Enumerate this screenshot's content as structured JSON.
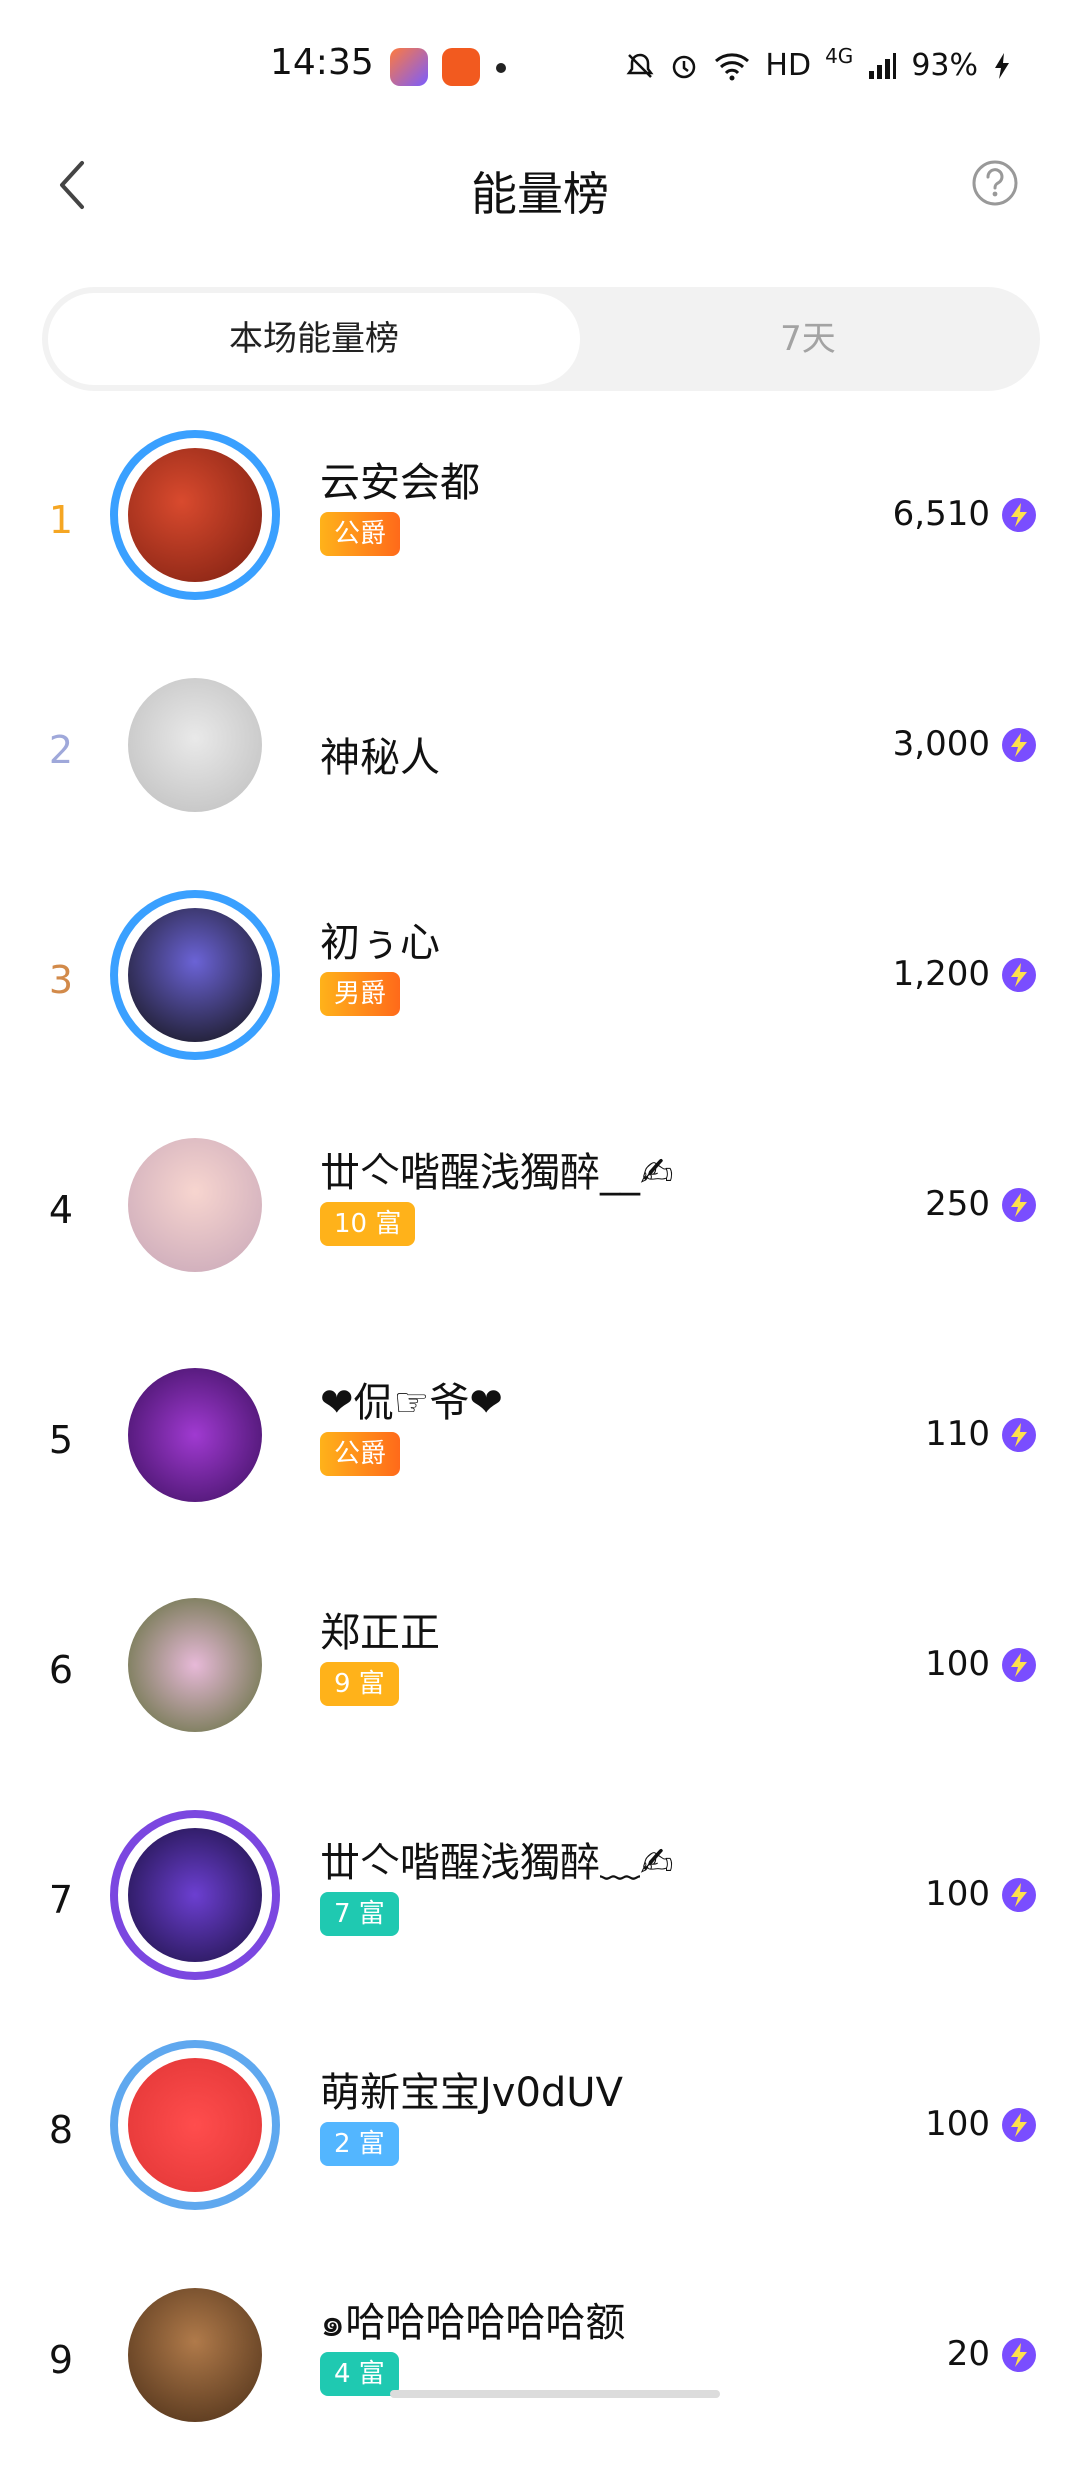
{
  "status_bar": {
    "time": "14:35",
    "network": "HD",
    "signal": "4G",
    "battery": "93%"
  },
  "header": {
    "title": "能量榜",
    "back_icon": "chevron-left-icon",
    "help_icon": "question-circle-icon"
  },
  "tabs": [
    {
      "label": "本场能量榜",
      "active": true
    },
    {
      "label": "7天",
      "active": false
    }
  ],
  "colors": {
    "rank_gold": "#f5a623",
    "rank_silver": "#9fa8da",
    "rank_bronze": "#d28a4a",
    "energy": "#7a4dff",
    "badge_orange": "#ff8a1f",
    "badge_yellow": "#ffb21a",
    "badge_teal": "#1fc9b1",
    "badge_blue": "#53b6ff"
  },
  "leaderboard": [
    {
      "rank": "1",
      "name": "云安会都",
      "badge": "公爵",
      "badge_style": "duke",
      "score": "6,510"
    },
    {
      "rank": "2",
      "name": "神秘人",
      "badge": "",
      "badge_style": "",
      "score": "3,000"
    },
    {
      "rank": "3",
      "name": "初ぅ心",
      "badge": "男爵",
      "badge_style": "duke",
      "score": "1,200"
    },
    {
      "rank": "4",
      "name": "丗亽喈醒浅獨醉__✍",
      "badge": "10 富",
      "badge_style": "rich-yellow",
      "score": "250"
    },
    {
      "rank": "5",
      "name": "❤侃☞爷❤",
      "badge": "公爵",
      "badge_style": "duke",
      "score": "110"
    },
    {
      "rank": "6",
      "name": "郑正正",
      "badge": "9 富",
      "badge_style": "rich-yellow",
      "score": "100"
    },
    {
      "rank": "7",
      "name": "丗亽喈醒浅獨醉﹏✍",
      "badge": "7 富",
      "badge_style": "rich-teal",
      "score": "100"
    },
    {
      "rank": "8",
      "name": "萌新宝宝Jv0dUV",
      "badge": "2 富",
      "badge_style": "rich-blue",
      "score": "100"
    },
    {
      "rank": "9",
      "name": "๑哈哈哈哈哈哈额",
      "badge": "4 富",
      "badge_style": "rich-teal",
      "score": "20"
    }
  ]
}
